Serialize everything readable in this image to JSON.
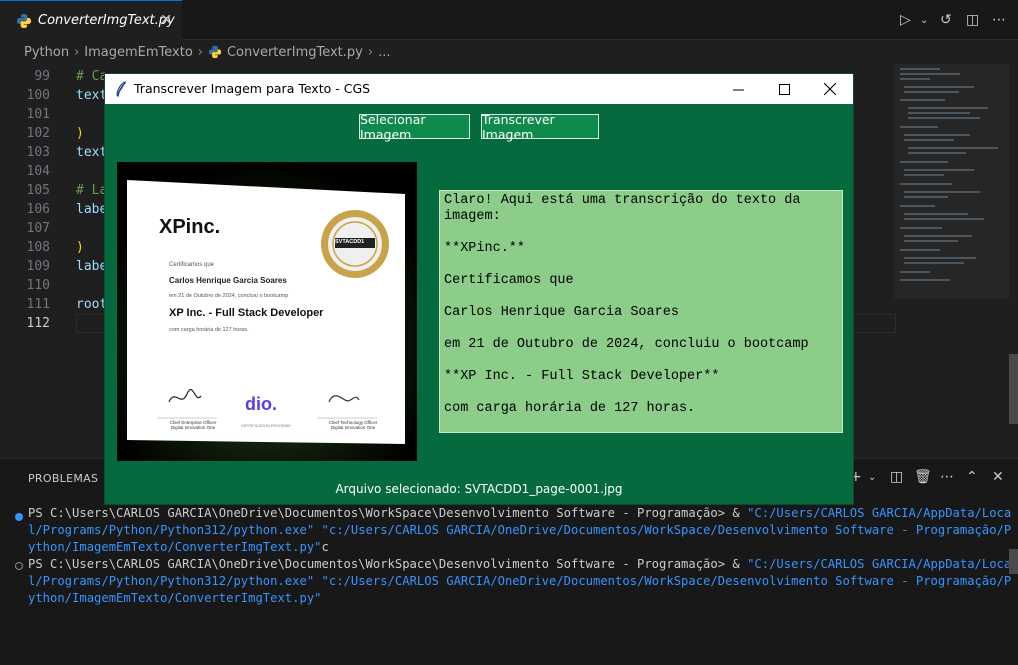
{
  "editor_tab": {
    "label": "ConverterImgText.py",
    "close": "✕"
  },
  "breadcrumb": [
    "Python",
    "ImagemEmTexto",
    "ConverterImgText.py",
    "..."
  ],
  "code_lines": [
    {
      "num": "99",
      "text": "# Ca"
    },
    {
      "num": "100",
      "text": "text"
    },
    {
      "num": "101",
      "text": ""
    },
    {
      "num": "102",
      "text": ")"
    },
    {
      "num": "103",
      "text": "text"
    },
    {
      "num": "104",
      "text": ""
    },
    {
      "num": "105",
      "text": "# La"
    },
    {
      "num": "106",
      "text": "labe"
    },
    {
      "num": "107",
      "text": ""
    },
    {
      "num": "108",
      "text": ")"
    },
    {
      "num": "109",
      "text": "labe"
    },
    {
      "num": "110",
      "text": ""
    },
    {
      "num": "111",
      "text": "root"
    },
    {
      "num": "112",
      "text": ""
    }
  ],
  "panel": {
    "tab": "PROBLEMAS",
    "lines": [
      {
        "prompt": "PS C:\\Users\\CARLOS GARCIA\\OneDrive\\Documentos\\WorkSpace\\Desenvolvimento Software - Programação> & ",
        "path1": "\"C:/Users/CARLOS GARCIA/AppData/Local/Programs/Python/Python312/python.exe\"",
        "path2": "\"c:/Users/CARLOS GARCIA/OneDrive/Documentos/WorkSpace/Desenvolvimento Software - Programação/Python/ImagemEmTexto/ConverterImgText.py\"",
        "tail": "c"
      },
      {
        "prompt": "PS C:\\Users\\CARLOS GARCIA\\OneDrive\\Documentos\\WorkSpace\\Desenvolvimento Software - Programação> & ",
        "path1": "\"C:/Users/CARLOS GARCIA/AppData/Local/Programs/Python/Python312/python.exe\"",
        "path2": "\"c:/Users/CARLOS GARCIA/OneDrive/Documentos/WorkSpace/Desenvolvimento Software - Programação/Python/ImagemEmTexto/ConverterImgText.py\"",
        "tail": ""
      }
    ]
  },
  "app_window": {
    "title": "Transcrever Imagem para Texto - CGS",
    "select_button": "Selecionar Imagem",
    "transcribe_button": "Transcrever Imagem",
    "transcription": "Claro! Aqui está uma transcrição do texto da\nimagem:\n\n**XPinc.**\n\nCertificamos que\n\nCarlos Henrique Garcia Soares\n\nem 21 de Outubro de 2024, concluiu o bootcamp\n\n**XP Inc. - Full Stack Developer**\n\ncom carga horária de 127 horas.",
    "file_label": "Arquivo selecionado: SVTACDD1_page-0001.jpg"
  },
  "certificate": {
    "logo": "XPinc.",
    "line1": "Certificamos que",
    "name": "Carlos Henrique Garcia Soares",
    "line2": "em 21 de Outubro de 2024, concluiu o bootcamp",
    "course": "XP Inc. - Full Stack Developer",
    "hours": "com carga horária de 127 horas.",
    "seal_code": "SVTACDD1",
    "sig1_role": "Chief Enterprise Officer\nDigital Innovation One",
    "sig2_mark": "dio.",
    "sig2_caption": "CERTIFICATION PROGRAM",
    "sig3_role": "Chief Technology Officer\nDigital Innovation One"
  },
  "colors": {
    "tk_bg": "#056a3e",
    "tk_button": "#0e8a4c",
    "text_area": "#8ccd8a",
    "accent": "#0078d4"
  }
}
